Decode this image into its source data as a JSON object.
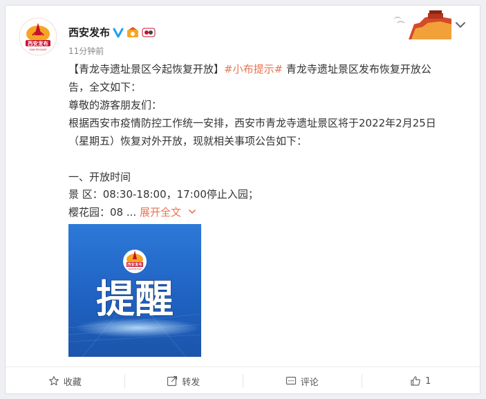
{
  "post": {
    "user_name": "西安发布",
    "time": "11分钟前",
    "lines": {
      "title": "【青龙寺遗址景区今起恢复开放】",
      "hashtag": "#小布提示#",
      "line1_rest": " 青龙寺遗址景区发布恢复开放公",
      "line2": "告，全文如下：",
      "line3": "尊敬的游客朋友们：",
      "line4": "根据西安市疫情防控工作统一安排，西安市青龙寺遗址景区将于2022年2月25日",
      "line5": "（星期五）恢复对外开放，现就相关事项公告如下：",
      "line6": "一、开放时间",
      "line7": "景 区：08:30-18:00，17:00停止入园；",
      "line8_prefix": "樱花园：08 ... ",
      "expand_label": "展开全文"
    },
    "image": {
      "logo_text": "西安发布",
      "logo_en": "XIAN RELEASE",
      "main_text": "提醒"
    }
  },
  "actions": {
    "favorite": "收藏",
    "repost": "转发",
    "comment": "评论",
    "like_count": "1"
  },
  "colors": {
    "accent": "#eb7350",
    "brand_red": "#c8102e",
    "verify_blue": "#1da1f2"
  }
}
